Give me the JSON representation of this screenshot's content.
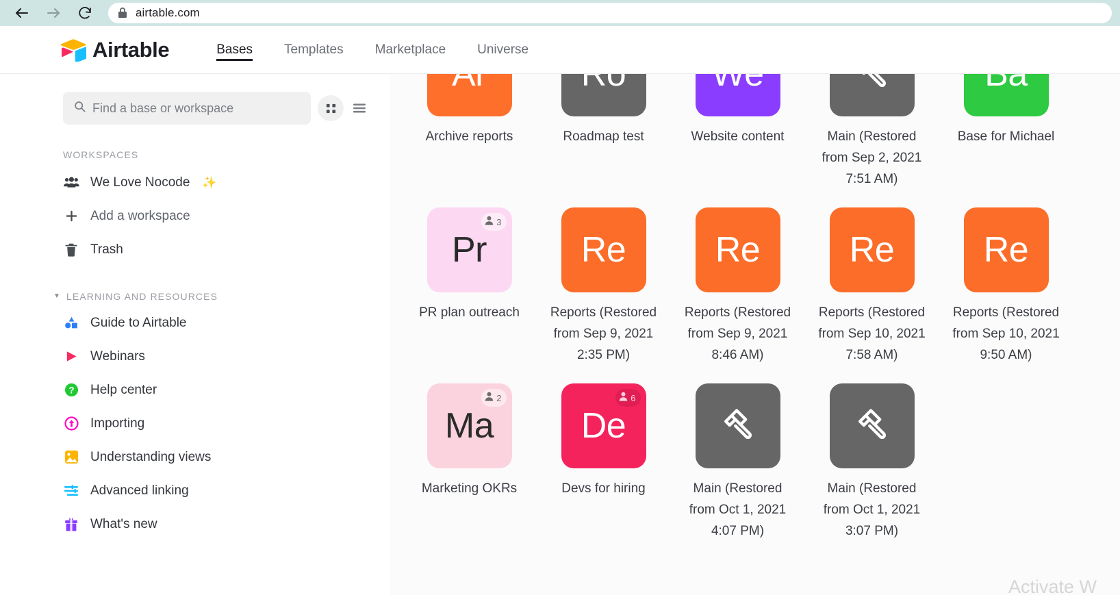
{
  "browser": {
    "back_icon": "arrow-left-icon",
    "forward_icon": "arrow-right-icon",
    "reload_icon": "reload-icon",
    "lock_icon": "lock-icon",
    "url": "airtable.com"
  },
  "header": {
    "logo_text": "Airtable",
    "nav": [
      {
        "label": "Bases",
        "active": true
      },
      {
        "label": "Templates",
        "active": false
      },
      {
        "label": "Marketplace",
        "active": false
      },
      {
        "label": "Universe",
        "active": false
      }
    ]
  },
  "sidebar": {
    "search": {
      "placeholder": "Find a base or workspace"
    },
    "grid_view_icon": "grid-view-icon",
    "list_view_icon": "list-view-icon",
    "workspaces_label": "WORKSPACES",
    "workspaces": [
      {
        "label": "We Love Nocode",
        "icon": "people-icon",
        "badge": "✨"
      },
      {
        "label": "Add a workspace",
        "icon": "plus-icon"
      },
      {
        "label": "Trash",
        "icon": "trash-icon"
      }
    ],
    "learning_label": "LEARNING AND RESOURCES",
    "learning": [
      {
        "label": "Guide to Airtable",
        "icon": "shapes-icon"
      },
      {
        "label": "Webinars",
        "icon": "play-triangle-icon"
      },
      {
        "label": "Help center",
        "icon": "question-circle-icon"
      },
      {
        "label": "Importing",
        "icon": "upload-circle-icon"
      },
      {
        "label": "Understanding views",
        "icon": "image-icon"
      },
      {
        "label": "Advanced linking",
        "icon": "sliders-icon"
      },
      {
        "label": "What's new",
        "icon": "gift-icon"
      }
    ]
  },
  "bases": [
    {
      "label": "Archive reports",
      "initials": "Ar",
      "color": "#FF6F2C",
      "text_color": "#ffffff",
      "clipped": true
    },
    {
      "label": "Roadmap test",
      "initials": "Ro",
      "color": "#666666",
      "text_color": "#ffffff",
      "clipped": true
    },
    {
      "label": "Website content",
      "initials": "We",
      "color": "#8B3DFF",
      "text_color": "#ffffff",
      "clipped": true
    },
    {
      "label": "Main (Restored\nfrom Sep 2, 2021\n7:51 AM)",
      "initials": "",
      "color": "#666666",
      "text_color": "#ffffff",
      "icon": "hammer-icon",
      "clipped": true
    },
    {
      "label": "Base for Michael",
      "initials": "Ba",
      "color": "#2DCA42",
      "text_color": "#ffffff",
      "clipped": true
    },
    {
      "label": "PR plan outreach",
      "initials": "Pr",
      "color": "#FCD8F2",
      "text_color": "#2b2b2b",
      "collaborators": 3,
      "badge_bg": "#FDECF8",
      "badge_fg": "#6b6b6b"
    },
    {
      "label": "Reports (Restored\nfrom Sep 9, 2021\n2:35 PM)",
      "initials": "Re",
      "color": "#FB6D29",
      "text_color": "#ffffff"
    },
    {
      "label": "Reports (Restored\nfrom Sep 9, 2021\n8:46 AM)",
      "initials": "Re",
      "color": "#FB6D29",
      "text_color": "#ffffff"
    },
    {
      "label": "Reports (Restored\nfrom Sep 10, 2021\n7:58 AM)",
      "initials": "Re",
      "color": "#FB6D29",
      "text_color": "#ffffff"
    },
    {
      "label": "Reports (Restored\nfrom Sep 10, 2021\n9:50 AM)",
      "initials": "Re",
      "color": "#FB6D29",
      "text_color": "#ffffff"
    },
    {
      "label": "Marketing OKRs",
      "initials": "Ma",
      "color": "#FBD3DE",
      "text_color": "#2b2b2b",
      "collaborators": 2,
      "badge_bg": "#FDE8EE",
      "badge_fg": "#6b6b6b"
    },
    {
      "label": "Devs for hiring",
      "initials": "De",
      "color": "#F5235C",
      "text_color": "#ffffff",
      "collaborators": 6,
      "badge_bg": "#E01E53",
      "badge_fg": "#ffd3df"
    },
    {
      "label": "Main (Restored\nfrom Oct 1, 2021\n4:07 PM)",
      "initials": "",
      "color": "#666666",
      "text_color": "#ffffff",
      "icon": "hammer-icon"
    },
    {
      "label": "Main (Restored\nfrom Oct 1, 2021\n3:07 PM)",
      "initials": "",
      "color": "#666666",
      "text_color": "#ffffff",
      "icon": "hammer-icon"
    }
  ],
  "watermark": "Activate W"
}
